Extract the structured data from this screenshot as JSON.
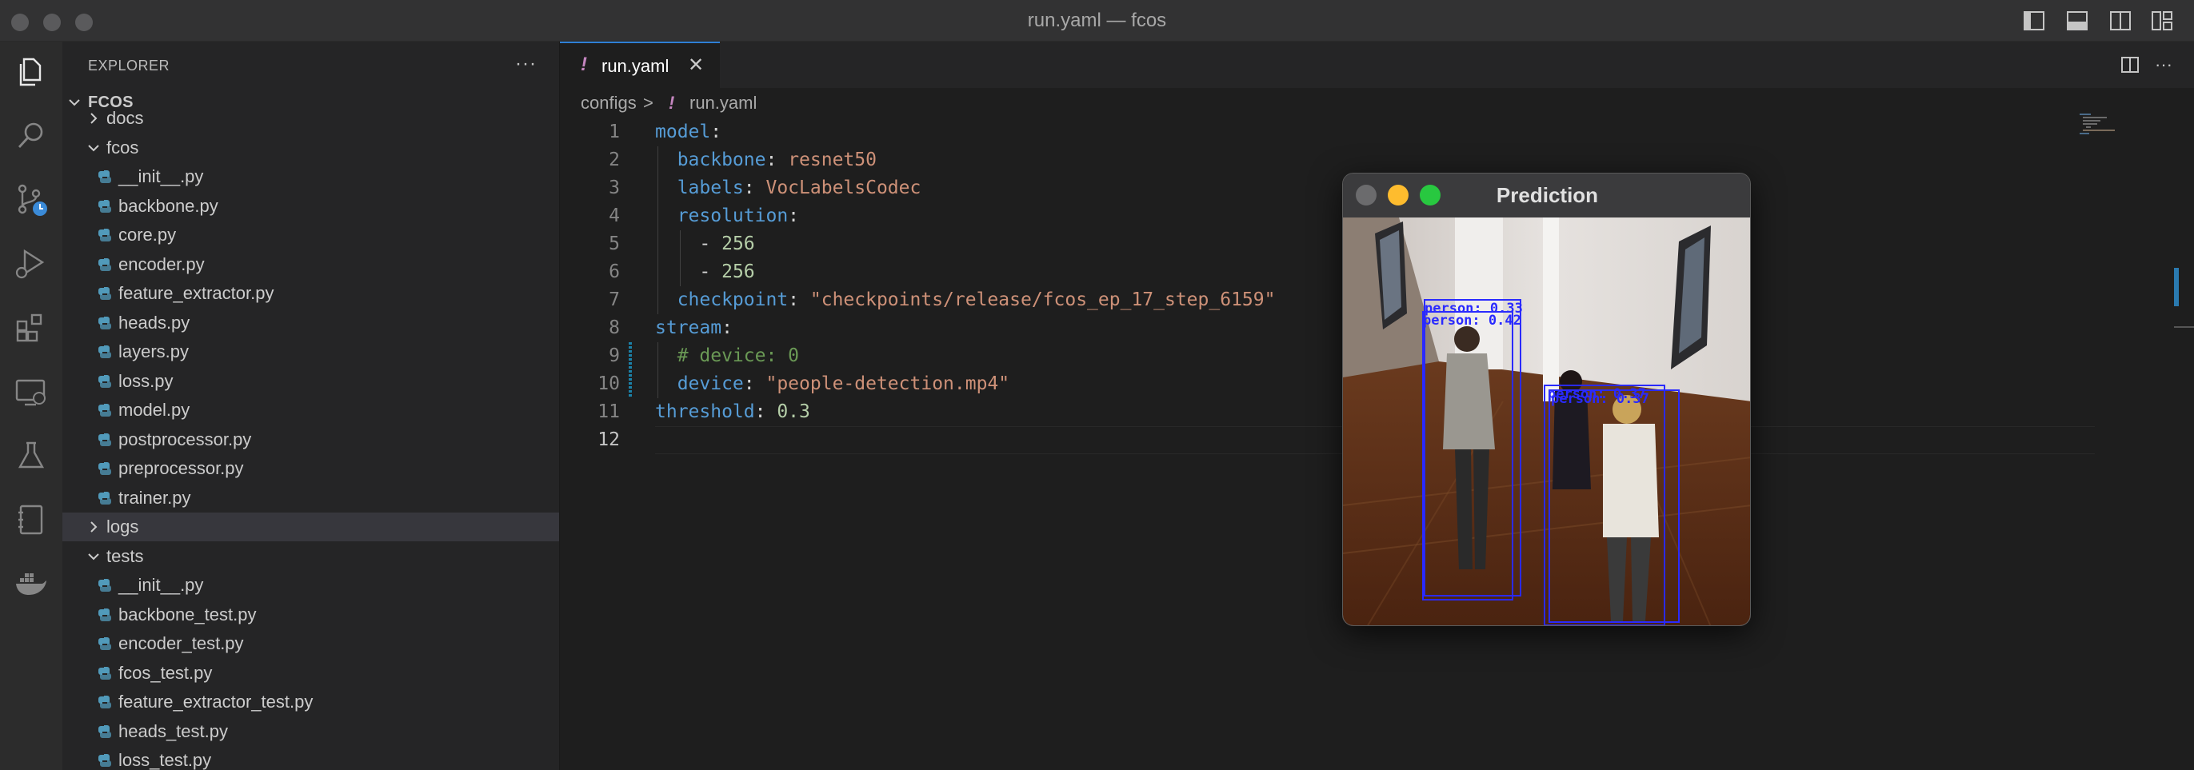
{
  "window": {
    "title": "run.yaml — fcos"
  },
  "activity_bar": [
    {
      "name": "explorer-icon",
      "active": true
    },
    {
      "name": "search-icon"
    },
    {
      "name": "source-control-icon"
    },
    {
      "name": "run-debug-icon"
    },
    {
      "name": "extensions-icon"
    },
    {
      "name": "remote-explorer-icon"
    },
    {
      "name": "testing-icon"
    },
    {
      "name": "notebook-icon"
    },
    {
      "name": "docker-icon"
    }
  ],
  "sidebar": {
    "header": "EXPLORER",
    "root": "FCOS",
    "items": [
      {
        "label": "docs",
        "kind": "folder",
        "collapsed": true,
        "depth": 1
      },
      {
        "label": "fcos",
        "kind": "folder",
        "collapsed": false,
        "depth": 1
      },
      {
        "label": "__init__.py",
        "kind": "py",
        "depth": 2
      },
      {
        "label": "backbone.py",
        "kind": "py",
        "depth": 2
      },
      {
        "label": "core.py",
        "kind": "py",
        "depth": 2
      },
      {
        "label": "encoder.py",
        "kind": "py",
        "depth": 2
      },
      {
        "label": "feature_extractor.py",
        "kind": "py",
        "depth": 2
      },
      {
        "label": "heads.py",
        "kind": "py",
        "depth": 2
      },
      {
        "label": "layers.py",
        "kind": "py",
        "depth": 2
      },
      {
        "label": "loss.py",
        "kind": "py",
        "depth": 2
      },
      {
        "label": "model.py",
        "kind": "py",
        "depth": 2
      },
      {
        "label": "postprocessor.py",
        "kind": "py",
        "depth": 2
      },
      {
        "label": "preprocessor.py",
        "kind": "py",
        "depth": 2
      },
      {
        "label": "trainer.py",
        "kind": "py",
        "depth": 2
      },
      {
        "label": "logs",
        "kind": "folder",
        "collapsed": true,
        "depth": 1,
        "selected": true
      },
      {
        "label": "tests",
        "kind": "folder",
        "collapsed": false,
        "depth": 1
      },
      {
        "label": "__init__.py",
        "kind": "py",
        "depth": 2
      },
      {
        "label": "backbone_test.py",
        "kind": "py",
        "depth": 2
      },
      {
        "label": "encoder_test.py",
        "kind": "py",
        "depth": 2
      },
      {
        "label": "fcos_test.py",
        "kind": "py",
        "depth": 2
      },
      {
        "label": "feature_extractor_test.py",
        "kind": "py",
        "depth": 2
      },
      {
        "label": "heads_test.py",
        "kind": "py",
        "depth": 2
      },
      {
        "label": "loss_test.py",
        "kind": "py",
        "depth": 2
      }
    ]
  },
  "editor": {
    "tab": {
      "label": "run.yaml",
      "marker": "!"
    },
    "breadcrumb": {
      "folder": "configs",
      "separator": ">",
      "marker": "!",
      "file": "run.yaml"
    },
    "active_line": 12,
    "lines": [
      {
        "n": "1",
        "tokens": [
          {
            "t": "model",
            "c": "k"
          },
          {
            "t": ":",
            "c": "p"
          }
        ]
      },
      {
        "n": "2",
        "tokens": [
          {
            "t": "  backbone",
            "c": "k"
          },
          {
            "t": ": ",
            "c": "p"
          },
          {
            "t": "resnet50",
            "c": "s"
          }
        ]
      },
      {
        "n": "3",
        "tokens": [
          {
            "t": "  labels",
            "c": "k"
          },
          {
            "t": ": ",
            "c": "p"
          },
          {
            "t": "VocLabelsCodec",
            "c": "s"
          }
        ]
      },
      {
        "n": "4",
        "tokens": [
          {
            "t": "  resolution",
            "c": "k"
          },
          {
            "t": ":",
            "c": "p"
          }
        ]
      },
      {
        "n": "5",
        "tokens": [
          {
            "t": "    - ",
            "c": "p"
          },
          {
            "t": "256",
            "c": "n"
          }
        ]
      },
      {
        "n": "6",
        "tokens": [
          {
            "t": "    - ",
            "c": "p"
          },
          {
            "t": "256",
            "c": "n"
          }
        ]
      },
      {
        "n": "7",
        "tokens": [
          {
            "t": "  checkpoint",
            "c": "k"
          },
          {
            "t": ": ",
            "c": "p"
          },
          {
            "t": "\"checkpoints/release/fcos_ep_17_step_6159\"",
            "c": "s"
          }
        ]
      },
      {
        "n": "8",
        "tokens": [
          {
            "t": "stream",
            "c": "k"
          },
          {
            "t": ":",
            "c": "p"
          }
        ]
      },
      {
        "n": "9",
        "tokens": [
          {
            "t": "  # device: 0",
            "c": "c"
          }
        ]
      },
      {
        "n": "10",
        "tokens": [
          {
            "t": "  device",
            "c": "k"
          },
          {
            "t": ": ",
            "c": "p"
          },
          {
            "t": "\"people-detection.mp4\"",
            "c": "s"
          }
        ]
      },
      {
        "n": "11",
        "tokens": [
          {
            "t": "threshold",
            "c": "k"
          },
          {
            "t": ": ",
            "c": "p"
          },
          {
            "t": "0.3",
            "c": "n"
          }
        ]
      },
      {
        "n": "12",
        "tokens": []
      }
    ]
  },
  "prediction_window": {
    "title": "Prediction",
    "detections": [
      {
        "label": "person: 0.33"
      },
      {
        "label": "person: 0.42"
      },
      {
        "label": "person: 0.37"
      },
      {
        "label": "person: 0.37"
      }
    ],
    "box_color": "#2a2aff"
  },
  "colors": {
    "accent": "#2f7fd6",
    "yaml_marker": "#c586c0",
    "python_icon": "#519aba"
  }
}
